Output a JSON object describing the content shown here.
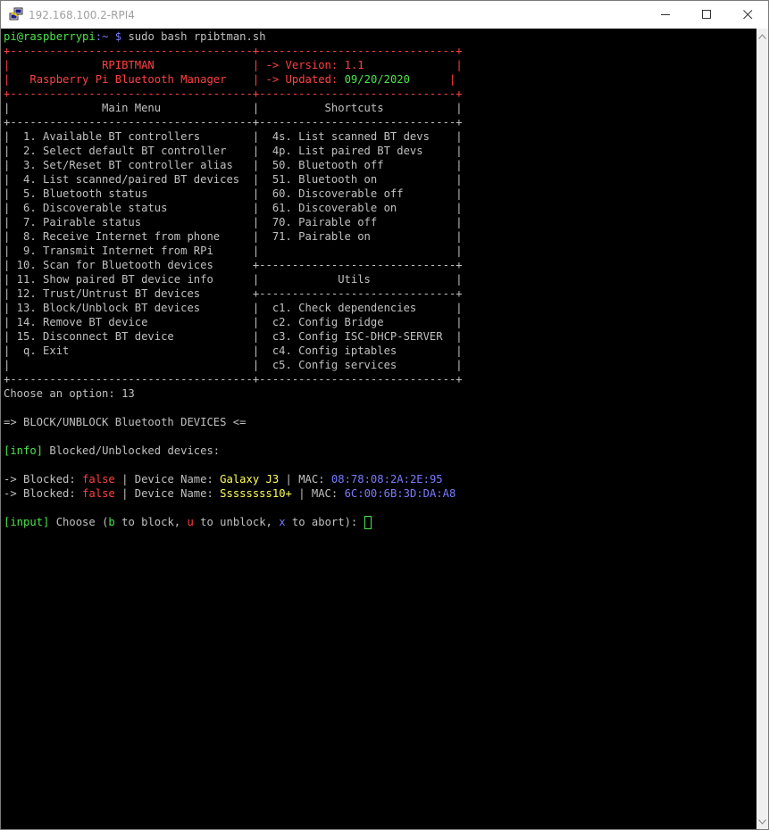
{
  "window": {
    "title": "192.168.100.2-RPI4",
    "controls": {
      "minimize": "—",
      "maximize": "☐",
      "close": "✕"
    }
  },
  "terminal": {
    "prompt_user": "pi@raspberrypi",
    "prompt_sep": ":~ $",
    "command": "sudo bash rpibtman.sh",
    "banner": {
      "border": "+----------------------------------------------------------------------+",
      "app_name": "RPIBTMAN",
      "app_full_name": "Raspberry Pi Bluetooth Manager",
      "version_label": "-> Version:",
      "version": "1.1",
      "updated_label": "-> Updated:",
      "updated": "09/20/2020"
    },
    "menu_title": "Main Menu",
    "shortcuts_title": "Shortcuts",
    "utils_title": "Utils",
    "menu_items": [
      "1. Available BT controllers",
      "2. Select default BT controller",
      "3. Set/Reset BT controller alias",
      "4. List scanned/paired BT devices",
      "5. Bluetooth status",
      "6. Discoverable status",
      "7. Pairable status",
      "8. Receive Internet from phone",
      "9. Transmit Internet from RPi",
      "10. Scan for Bluetooth devices",
      "11. Show paired BT device info",
      "12. Trust/Untrust BT devices",
      "13. Block/Unblock BT devices",
      "14. Remove BT device",
      "15. Disconnect BT device",
      "q. Exit"
    ],
    "shortcuts": [
      "4s. List scanned BT devs",
      "4p. List paired BT devs",
      "50. Bluetooth off",
      "51. Bluetooth on",
      "60. Discoverable off",
      "61. Discoverable on",
      "70. Pairable off",
      "71. Pairable on"
    ],
    "utils": [
      "c1. Check dependencies",
      "c2. Config Bridge",
      "c3. Config ISC-DHCP-SERVER",
      "c4. Config iptables",
      "c5. Config services"
    ],
    "choose_option_label": "Choose an option:",
    "choose_option_value": "13",
    "section_header": "=> BLOCK/UNBLOCK Bluetooth DEVICES <=",
    "info_tag": "[info]",
    "info_text": "Blocked/Unblocked devices:",
    "device_labels": {
      "arrow": "->",
      "blocked": "Blocked:",
      "name": "Device Name:",
      "mac": "MAC:",
      "sep": "|"
    },
    "devices": [
      {
        "blocked": "false",
        "name": "Galaxy J3",
        "mac": "08:78:08:2A:2E:95"
      },
      {
        "blocked": "false",
        "name": "Ssssssss10+",
        "mac": "6C:00:6B:3D:DA:A8"
      }
    ],
    "input_tag": "[input]",
    "input_prompt": {
      "open": "Choose (",
      "b": "b",
      "to_block": " to block, ",
      "u": "u",
      "to_unblock": " to unblock, ",
      "x": "x",
      "to_abort": " to abort):"
    }
  }
}
